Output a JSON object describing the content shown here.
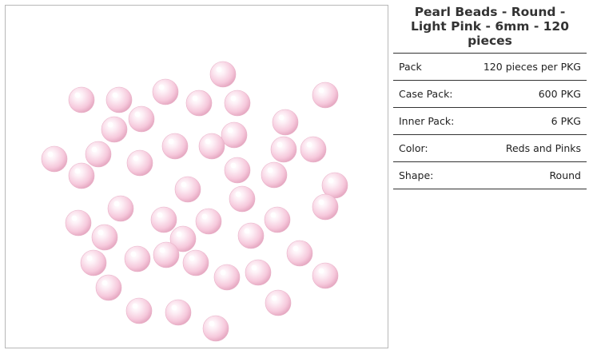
{
  "product": {
    "title": "Pearl Beads - Round - Light Pink - 6mm - 120 pieces",
    "image_alt": "Light pink round pearl beads"
  },
  "specs": [
    {
      "label": "Pack",
      "value": "120 pieces per PKG"
    },
    {
      "label": "Case Pack:",
      "value": "600 PKG"
    },
    {
      "label": "Inner Pack:",
      "value": "6 PKG"
    },
    {
      "label": "Color:",
      "value": "Reds and Pinks"
    },
    {
      "label": "Shape:",
      "value": "Round"
    }
  ],
  "colors": {
    "bead_light": "#fdf0f6",
    "bead_mid": "#f6c9dc",
    "bead_dark": "#e3a3bd",
    "frame_border": "#b8b8b8",
    "rule": "#333333"
  }
}
